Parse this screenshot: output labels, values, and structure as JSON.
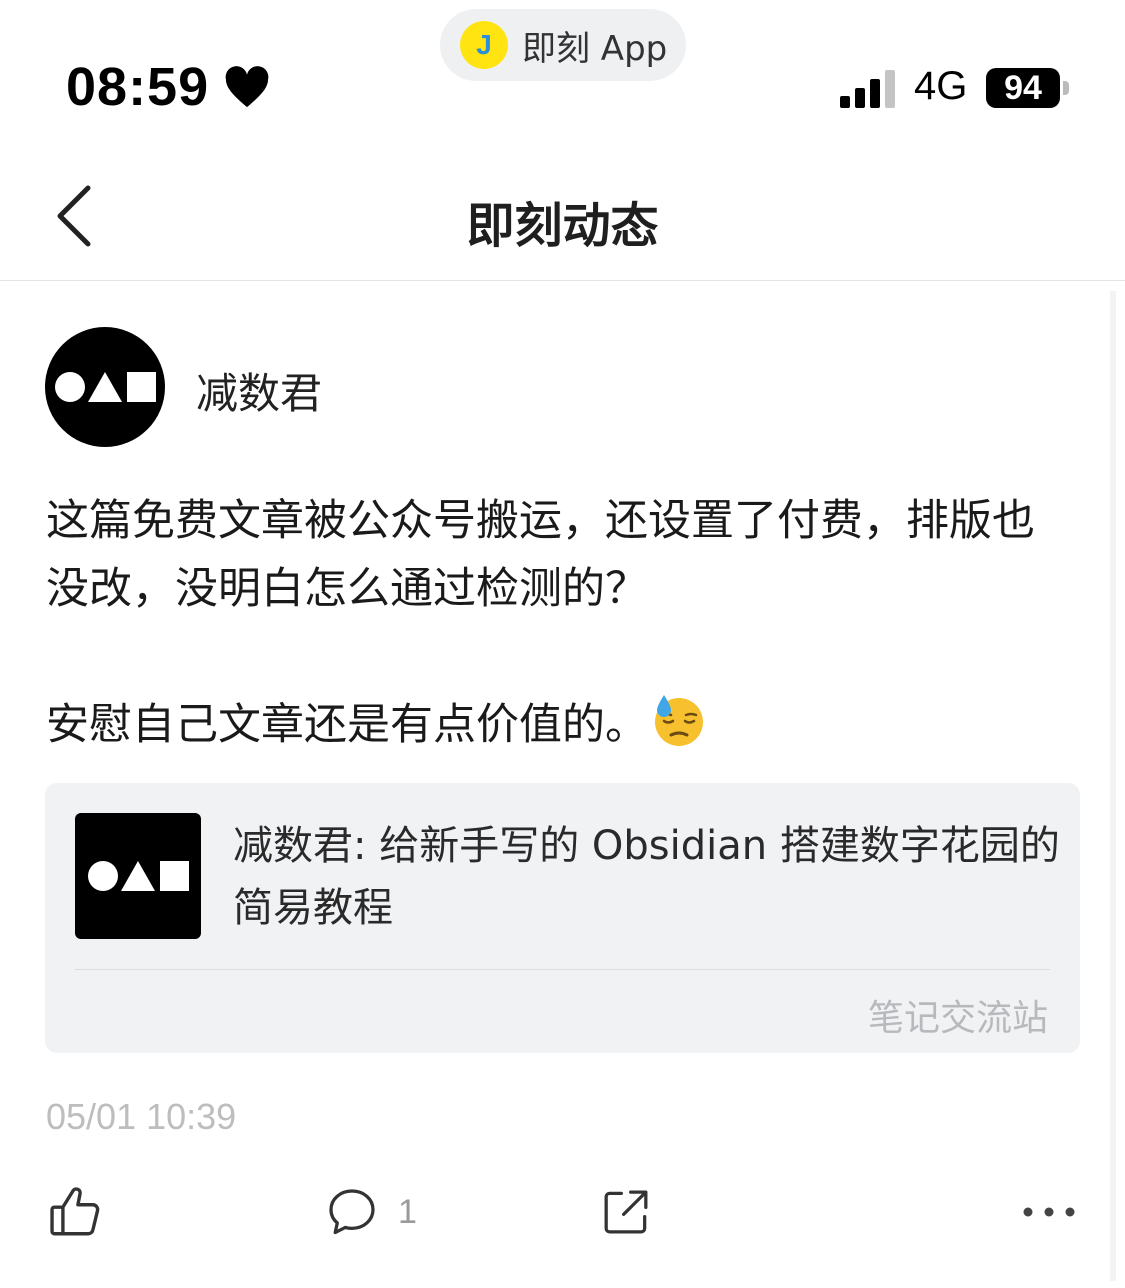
{
  "status_bar": {
    "app_pill_logo": "J",
    "app_pill_label": "即刻 App",
    "time": "08:59",
    "network": "4G",
    "battery": "94"
  },
  "nav": {
    "title": "即刻动态",
    "back_icon": "chevron-left-icon"
  },
  "post": {
    "author": "减数君",
    "paragraphs": [
      "这篇免费文章被公众号搬运，还设置了付费，排版也没改，没明白怎么通过检测的？",
      "安慰自己文章还是有点价值的。"
    ],
    "emoji": "downcast-face-with-sweat",
    "link_card": {
      "title": "减数君: 给新手写的 Obsidian 搭建数字花园的简易教程",
      "source": "笔记交流站"
    },
    "timestamp": "05/01 10:39",
    "actions": {
      "like_icon": "thumbs-up-icon",
      "comment_icon": "comment-icon",
      "comment_count": "1",
      "share_icon": "share-icon",
      "more_icon": "more-icon"
    }
  },
  "colors": {
    "jike_yellow": "#ffe411",
    "card_bg": "#f1f2f4",
    "muted_text": "#bdbdbd"
  }
}
